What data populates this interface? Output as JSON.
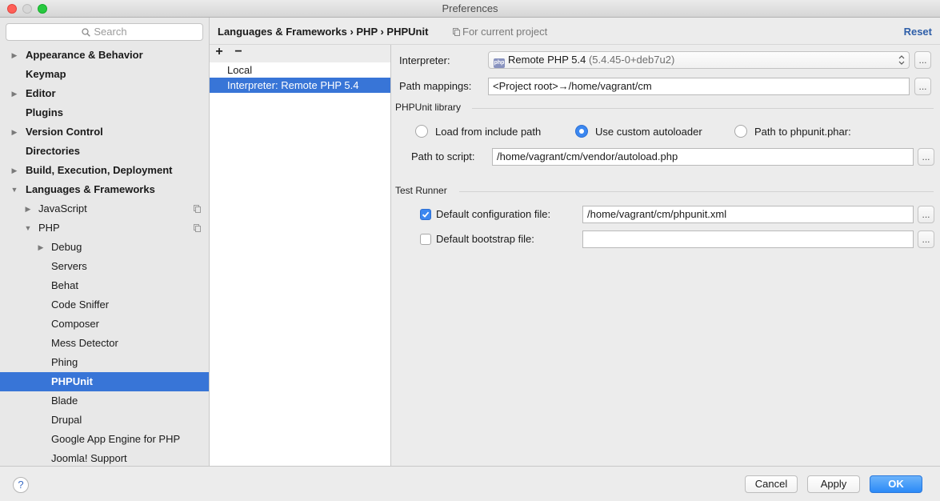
{
  "window": {
    "title": "Preferences"
  },
  "sidebar": {
    "search_placeholder": "Search",
    "items": [
      {
        "label": "Appearance & Behavior"
      },
      {
        "label": "Keymap"
      },
      {
        "label": "Editor"
      },
      {
        "label": "Plugins"
      },
      {
        "label": "Version Control"
      },
      {
        "label": "Directories"
      },
      {
        "label": "Build, Execution, Deployment"
      },
      {
        "label": "Languages & Frameworks"
      },
      {
        "label": "JavaScript"
      },
      {
        "label": "PHP"
      },
      {
        "label": "Debug"
      },
      {
        "label": "Servers"
      },
      {
        "label": "Behat"
      },
      {
        "label": "Code Sniffer"
      },
      {
        "label": "Composer"
      },
      {
        "label": "Mess Detector"
      },
      {
        "label": "Phing"
      },
      {
        "label": "PHPUnit"
      },
      {
        "label": "Blade"
      },
      {
        "label": "Drupal"
      },
      {
        "label": "Google App Engine for PHP"
      },
      {
        "label": "Joomla! Support"
      }
    ]
  },
  "header": {
    "breadcrumb": "Languages & Frameworks › PHP › PHPUnit",
    "scope": "For current project",
    "reset": "Reset"
  },
  "interpreters": {
    "add": "+",
    "remove": "−",
    "items": [
      {
        "label": "Local"
      },
      {
        "label": "Interpreter: Remote PHP 5.4"
      }
    ]
  },
  "form": {
    "interpreter_label": "Interpreter:",
    "interpreter_value": "Remote PHP 5.4",
    "interpreter_detail": "(5.4.45-0+deb7u2)",
    "path_mappings_label": "Path mappings:",
    "path_mappings_value": "<Project root>→/home/vagrant/cm",
    "browse": "...",
    "library_section": "PHPUnit library",
    "radio_include_path": "Load from include path",
    "radio_custom_autoloader": "Use custom autoloader",
    "radio_phar": "Path to phpunit.phar:",
    "path_to_script_label": "Path to script:",
    "path_to_script_value": "/home/vagrant/cm/vendor/autoload.php",
    "runner_section": "Test Runner",
    "default_config_label": "Default configuration file:",
    "default_config_value": "/home/vagrant/cm/phpunit.xml",
    "default_bootstrap_label": "Default bootstrap file:",
    "default_bootstrap_value": ""
  },
  "buttons": {
    "help": "?",
    "cancel": "Cancel",
    "apply": "Apply",
    "ok": "OK"
  },
  "colors": {
    "selection": "#3875d7",
    "accent": "#3b87f0",
    "link": "#2e5ea8"
  }
}
